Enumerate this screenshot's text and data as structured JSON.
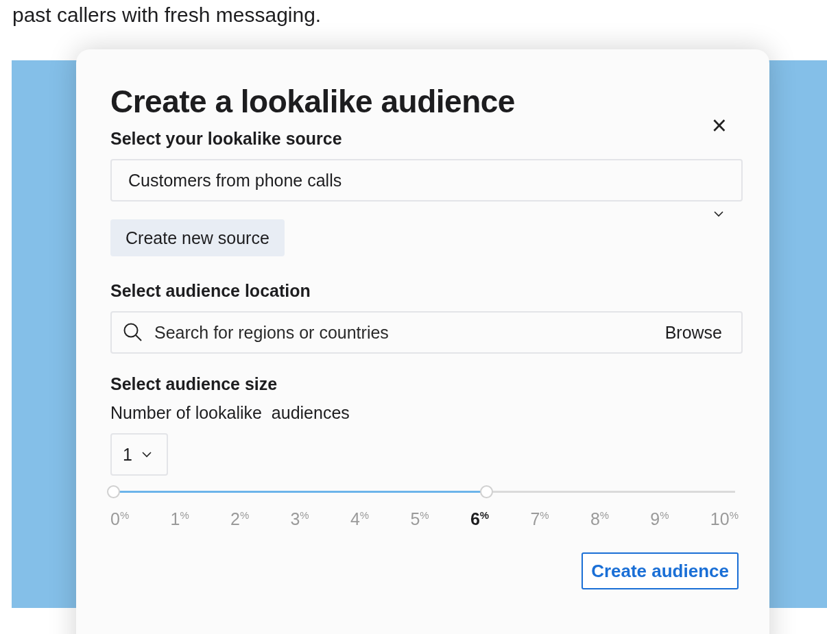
{
  "page_text": "past callers with fresh messaging.",
  "dialog": {
    "title": "Create a lookalike audience",
    "close": "×",
    "source": {
      "label": "Select your lookalike source",
      "value": "Customers from phone calls",
      "create_button": "Create new source"
    },
    "location": {
      "label": "Select audience location",
      "placeholder": "Search for regions or countries",
      "browse": "Browse"
    },
    "size": {
      "label": "Select audience size",
      "count_label": "Number of lookalike  audiences",
      "count_value": "1",
      "slider": {
        "level": 0.6
      },
      "ticks": [
        {
          "label": "0$^{%}$",
          "selected": false
        },
        {
          "label": "1$^{%}$",
          "selected": false
        },
        {
          "label": "2$^{%}$",
          "selected": false
        },
        {
          "label": "3$^{%}$",
          "selected": false
        },
        {
          "label": "4$^{%}$",
          "selected": false
        },
        {
          "label": "5$^{%}$",
          "selected": false
        },
        {
          "label": "6$^{%}$",
          "selected": true
        },
        {
          "label": "7$^{%}$",
          "selected": false
        },
        {
          "label": "8$^{%}$",
          "selected": false
        },
        {
          "label": "9$^{%}$",
          "selected": false
        },
        {
          "label": "10$^{%}$",
          "selected": false
        }
      ]
    },
    "submit": "Create audience"
  }
}
